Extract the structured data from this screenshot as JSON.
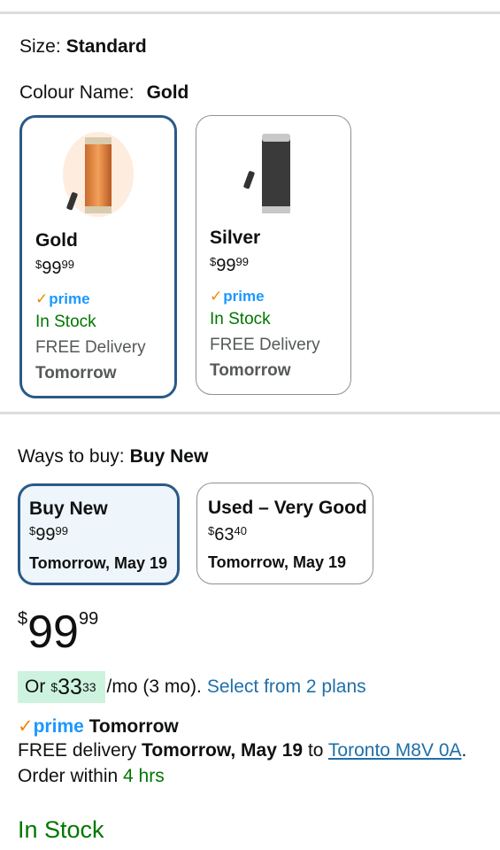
{
  "size": {
    "label": "Size:",
    "value": "Standard"
  },
  "colour": {
    "label": "Colour Name:",
    "value": "Gold"
  },
  "swatches": [
    {
      "name": "Gold",
      "currency": "$",
      "whole": "99",
      "cents": "99",
      "prime": "prime",
      "stock": "In Stock",
      "free": "FREE Delivery",
      "when": "Tomorrow",
      "image": "gold-heater-image"
    },
    {
      "name": "Silver",
      "currency": "$",
      "whole": "99",
      "cents": "99",
      "prime": "prime",
      "stock": "In Stock",
      "free": "FREE Delivery",
      "when": "Tomorrow",
      "image": "silver-heater-image"
    }
  ],
  "ways": {
    "label": "Ways to buy:",
    "value": "Buy New"
  },
  "buy_options": [
    {
      "title": "Buy New",
      "currency": "$",
      "whole": "99",
      "cents": "99",
      "date": "Tomorrow, May 19"
    },
    {
      "title": "Used – Very Good",
      "currency": "$",
      "whole": "63",
      "cents": "40",
      "date": "Tomorrow, May 19"
    }
  ],
  "price": {
    "currency": "$",
    "whole": "99",
    "cents": "99"
  },
  "plan": {
    "prefix": "Or",
    "currency": "$",
    "whole": "33",
    "cents": "33",
    "suffix": "/mo (3 mo).",
    "link": "Select from 2 plans"
  },
  "delivery": {
    "prime": "prime",
    "prime_when": "Tomorrow",
    "free_label": "FREE delivery",
    "date": "Tomorrow, May 19",
    "to": "to",
    "location": "Toronto M8V 0A",
    "period": ".",
    "order_prefix": "Order within",
    "order_time": "4 hrs"
  },
  "stock_status": "In Stock",
  "colors": {
    "prime_blue": "#1a98ff",
    "stock_green": "#007600",
    "selected_border": "#2a5a87",
    "link": "#1f6fa8"
  }
}
